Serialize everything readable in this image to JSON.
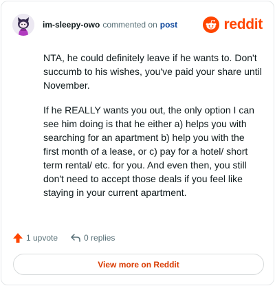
{
  "comment": {
    "username": "im-sleepy-owo",
    "action_text": "commented on",
    "post_link": "post",
    "paragraphs": [
      "NTA, he could definitely leave if he wants to. Don't succumb to his wishes, you've paid your share until November.",
      "If he REALLY wants you out, the only option I can see him doing is that he either a) helps you with searching for an apartment b) help you with the first month of a lease, or c) pay for a hotel/ short term rental/ etc. for you. And even then, you still don't need to accept those deals if you feel like staying in your current apartment."
    ]
  },
  "brand": {
    "name": "reddit",
    "color": "#ff4500"
  },
  "actions": {
    "upvote_label": "1 upvote",
    "replies_label": "0 replies"
  },
  "footer": {
    "view_more_label": "View more on Reddit"
  },
  "icons": {
    "avatar": "user-avatar-icon",
    "brand": "reddit-logo-icon",
    "upvote": "upvote-arrow-icon",
    "reply": "reply-arrow-icon"
  }
}
